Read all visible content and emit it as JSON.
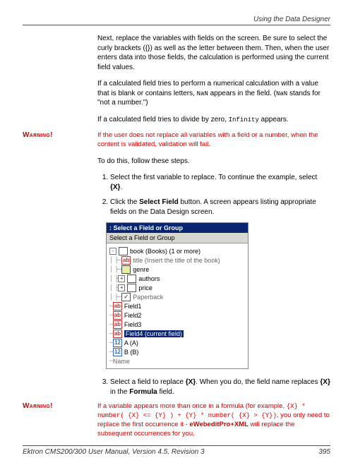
{
  "header": {
    "title": "Using the Data Designer"
  },
  "paragraphs": {
    "p1": "Next, replace the variables with fields on the screen. Be sure to select the curly brackets ({}) as well as the letter between them. Then, when the user enters data into those fields, the calculation is performed using the current field values.",
    "p2a": "If a calculated field tries to perform a numerical calculation with a value that is blank or contains letters, ",
    "p2nan": "NaN",
    "p2b": " appears in the field. (",
    "p2c": " stands for \"not a number.\")",
    "p3a": "If a calculated field tries to divide by zero, ",
    "p3inf": "Infinity",
    "p3b": " appears.",
    "p4": "To do this, follow these steps."
  },
  "warning1": {
    "label": "Warning!",
    "text": "If the user does not replace all variables with a field or a number, when the content is validated, validation will fail."
  },
  "steps": {
    "s1a": "Select the first variable to replace. To continue the example, select ",
    "s1b": "{X}",
    "s1c": ".",
    "s2a": "Click the ",
    "s2b": "Select Field",
    "s2c": " button. A screen appears listing appropriate fields on the Data Design screen.",
    "s3a": "Select a field to replace ",
    "s3b": "{X}",
    "s3c": ". When you do, the field name replaces ",
    "s3d": "{X}",
    "s3e": " in the ",
    "s3f": "Formula",
    "s3g": " field."
  },
  "dialog": {
    "titlebar": ": Select a Field or Group",
    "subtitle": "Select a Field or Group",
    "tree": [
      {
        "indent": 0,
        "box": "-",
        "icon": "page",
        "label": "book (Books) (1 or more)",
        "dim": false
      },
      {
        "indent": 1,
        "box": "",
        "icon": "ab",
        "label": "title (Insert the title of the book)",
        "dim": true
      },
      {
        "indent": 1,
        "box": "",
        "icon": "tag",
        "label": "genre",
        "dim": false
      },
      {
        "indent": 1,
        "box": "+",
        "icon": "page",
        "label": "authors",
        "dim": false
      },
      {
        "indent": 1,
        "box": "+",
        "icon": "page",
        "label": "price",
        "dim": false
      },
      {
        "indent": 1,
        "box": "",
        "icon": "chk",
        "label": "Paperback",
        "dim": true
      },
      {
        "indent": 0,
        "box": "",
        "icon": "ab",
        "label": "Field1",
        "dim": false
      },
      {
        "indent": 0,
        "box": "",
        "icon": "ab",
        "label": "Field2",
        "dim": false
      },
      {
        "indent": 0,
        "box": "",
        "icon": "ab",
        "label": "Field3",
        "dim": false
      },
      {
        "indent": 0,
        "box": "",
        "icon": "ab",
        "label": "Field4 (current field)",
        "dim": false,
        "selected": true
      },
      {
        "indent": 0,
        "box": "",
        "icon": "12",
        "label": "A (A)",
        "dim": false
      },
      {
        "indent": 0,
        "box": "",
        "icon": "12",
        "label": "B (B)",
        "dim": false
      },
      {
        "indent": 0,
        "box": "",
        "icon": "none",
        "label": "Name",
        "dim": true
      }
    ]
  },
  "warning2": {
    "label": "Warning!",
    "t1": "If a variable appears more than once in a formula (for example, ",
    "formula": "{X} * number( {X} <= {Y} ) + {Y} * number( {X} > {Y})",
    "t2": ", you only need to replace the first occurrence it - ",
    "bold": "eWebeditPro+XML",
    "t3": " will replace the subsequent occurrences for you."
  },
  "footer": {
    "left": "Ektron CMS200/300 User Manual, Version 4.5, Revision 3",
    "right": "395"
  }
}
